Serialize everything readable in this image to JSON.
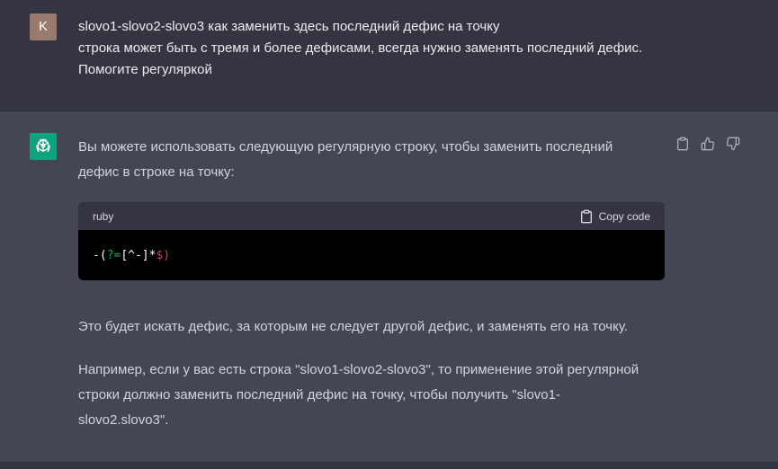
{
  "user": {
    "avatar_letter": "K",
    "lines": [
      "slovo1-slovo2-slovo3 как заменить здесь последний дефис на точку",
      "строка может быть с тремя и более дефисами, всегда нужно заменять последний дефис.",
      "Помогите регуляркой"
    ]
  },
  "assistant": {
    "para1_line1": "Вы можете использовать следующую регулярную строку, чтобы заменить последний",
    "para1_line2": "дефис в строке на точку:",
    "code": {
      "language": "ruby",
      "copy_label": "Copy code",
      "tokens": {
        "t1": "-(",
        "t2": "?=",
        "t3": "[^-]*",
        "t4": "$",
        "t5": ")"
      }
    },
    "para2": "Это будет искать дефис, за которым не следует другой дефис, и заменять его на точку.",
    "para3_line1": "Например, если у вас есть строка \"slovo1-slovo2-slovo3\", то применение этой регулярной",
    "para3_line2": "строки должно заменить последний дефис на точку, чтобы получить \"slovo1-",
    "para3_line3": "slovo2.slovo3\"."
  },
  "icons": {
    "copy": "clipboard-icon",
    "thumbs_up": "thumbs-up-icon",
    "thumbs_down": "thumbs-down-icon",
    "assistant_logo": "openai-logo-icon"
  },
  "colors": {
    "user_bg": "#343541",
    "assistant_bg": "#444654",
    "bot_avatar": "#10a37f",
    "user_avatar": "#9a7a6c"
  }
}
